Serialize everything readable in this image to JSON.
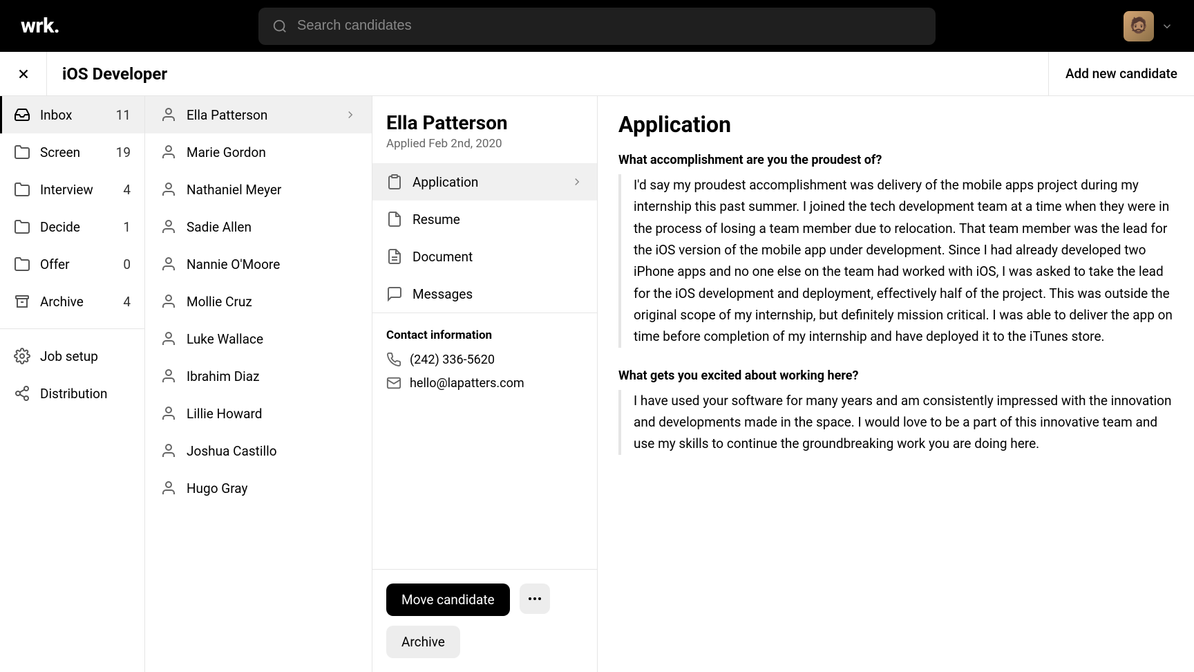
{
  "app": {
    "logo": "wrk.",
    "search_placeholder": "Search candidates"
  },
  "header": {
    "job_title": "iOS Developer",
    "add_button": "Add new candidate"
  },
  "stages": {
    "items": [
      {
        "label": "Inbox",
        "count": "11",
        "icon": "inbox",
        "active": true
      },
      {
        "label": "Screen",
        "count": "19",
        "icon": "folder"
      },
      {
        "label": "Interview",
        "count": "4",
        "icon": "folder"
      },
      {
        "label": "Decide",
        "count": "1",
        "icon": "folder"
      },
      {
        "label": "Offer",
        "count": "0",
        "icon": "folder"
      },
      {
        "label": "Archive",
        "count": "4",
        "icon": "archive"
      }
    ],
    "footer": [
      {
        "label": "Job setup",
        "icon": "gear"
      },
      {
        "label": "Distribution",
        "icon": "share"
      }
    ]
  },
  "candidates": [
    {
      "name": "Ella Patterson",
      "active": true
    },
    {
      "name": "Marie Gordon"
    },
    {
      "name": "Nathaniel Meyer"
    },
    {
      "name": "Sadie Allen"
    },
    {
      "name": "Nannie O'Moore"
    },
    {
      "name": "Mollie Cruz"
    },
    {
      "name": "Luke Wallace"
    },
    {
      "name": "Ibrahim Diaz"
    },
    {
      "name": "Lillie Howard"
    },
    {
      "name": "Joshua Castillo"
    },
    {
      "name": "Hugo Gray"
    }
  ],
  "detail": {
    "name": "Ella Patterson",
    "applied": "Applied Feb 2nd, 2020",
    "tabs": [
      {
        "label": "Application",
        "icon": "clipboard",
        "active": true
      },
      {
        "label": "Resume",
        "icon": "file"
      },
      {
        "label": "Document",
        "icon": "doc"
      },
      {
        "label": "Messages",
        "icon": "message"
      }
    ],
    "contact": {
      "heading": "Contact information",
      "phone": "(242) 336-5620",
      "email": "hello@lapatters.com"
    },
    "actions": {
      "move": "Move candidate",
      "archive": "Archive"
    }
  },
  "content": {
    "title": "Application",
    "qa": [
      {
        "question": "What accomplishment are you the proudest of?",
        "answer": "I'd say my proudest accomplishment was delivery of the mobile apps project during my internship this past summer. I joined the tech development team at a time when they were in the process of losing a team member due to relocation. That team member was the lead for the iOS version of the mobile app under development. Since I had already developed two iPhone apps and no one else on the team had worked with iOS, I was asked to take the lead for the iOS development and deployment, effectively half of the project. This was outside the original scope of my internship, but definitely mission critical. I was able to deliver the app on time before completion of my internship and have deployed it to the iTunes store."
      },
      {
        "question": "What gets you excited about working here?",
        "answer": "I have used your software for many years and am consistently impressed with the innovation and developments made in the space. I would love to be a part of this innovative team and use my skills to continue the groundbreaking work you are doing here."
      }
    ]
  }
}
